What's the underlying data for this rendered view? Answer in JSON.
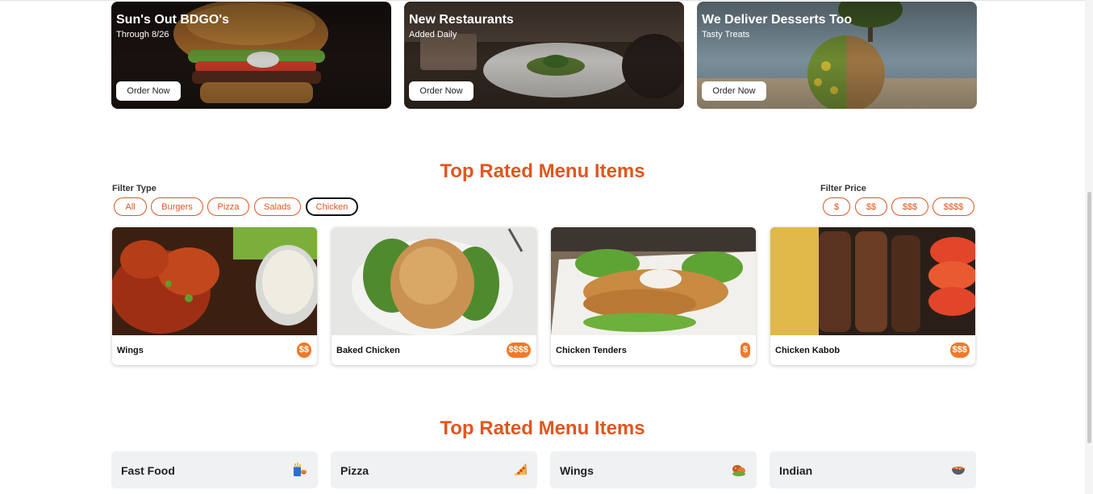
{
  "promos": [
    {
      "title": "Sun's Out BDGO's",
      "subtitle": "Through 8/26",
      "button": "Order Now"
    },
    {
      "title": "New Restaurants",
      "subtitle": "Added Daily",
      "button": "Order Now"
    },
    {
      "title": "We Deliver Desserts Too",
      "subtitle": "Tasty Treats",
      "button": "Order Now"
    }
  ],
  "menu_section": {
    "title": "Top Rated Menu Items",
    "filter_type_label": "Filter Type",
    "filter_types": [
      "All",
      "Burgers",
      "Pizza",
      "Salads",
      "Chicken"
    ],
    "active_filter_type": "Chicken",
    "filter_price_label": "Filter Price",
    "filter_prices": [
      "$",
      "$$",
      "$$$",
      "$$$$"
    ],
    "items": [
      {
        "name": "Wings",
        "price": "$$"
      },
      {
        "name": "Baked Chicken",
        "price": "$$$$"
      },
      {
        "name": "Chicken Tenders",
        "price": "$"
      },
      {
        "name": "Chicken Kabob",
        "price": "$$$"
      }
    ]
  },
  "category_section": {
    "title": "Top Rated Menu Items",
    "categories": [
      {
        "label": "Fast Food",
        "icon": "fast-food-icon"
      },
      {
        "label": "Pizza",
        "icon": "pizza-icon"
      },
      {
        "label": "Wings",
        "icon": "wings-icon"
      },
      {
        "label": "Indian",
        "icon": "curry-bowl-icon"
      }
    ]
  },
  "colors": {
    "accent": "#e0561f",
    "price_badge": "#ee7a2a",
    "category_bg": "#f0f1f3"
  }
}
